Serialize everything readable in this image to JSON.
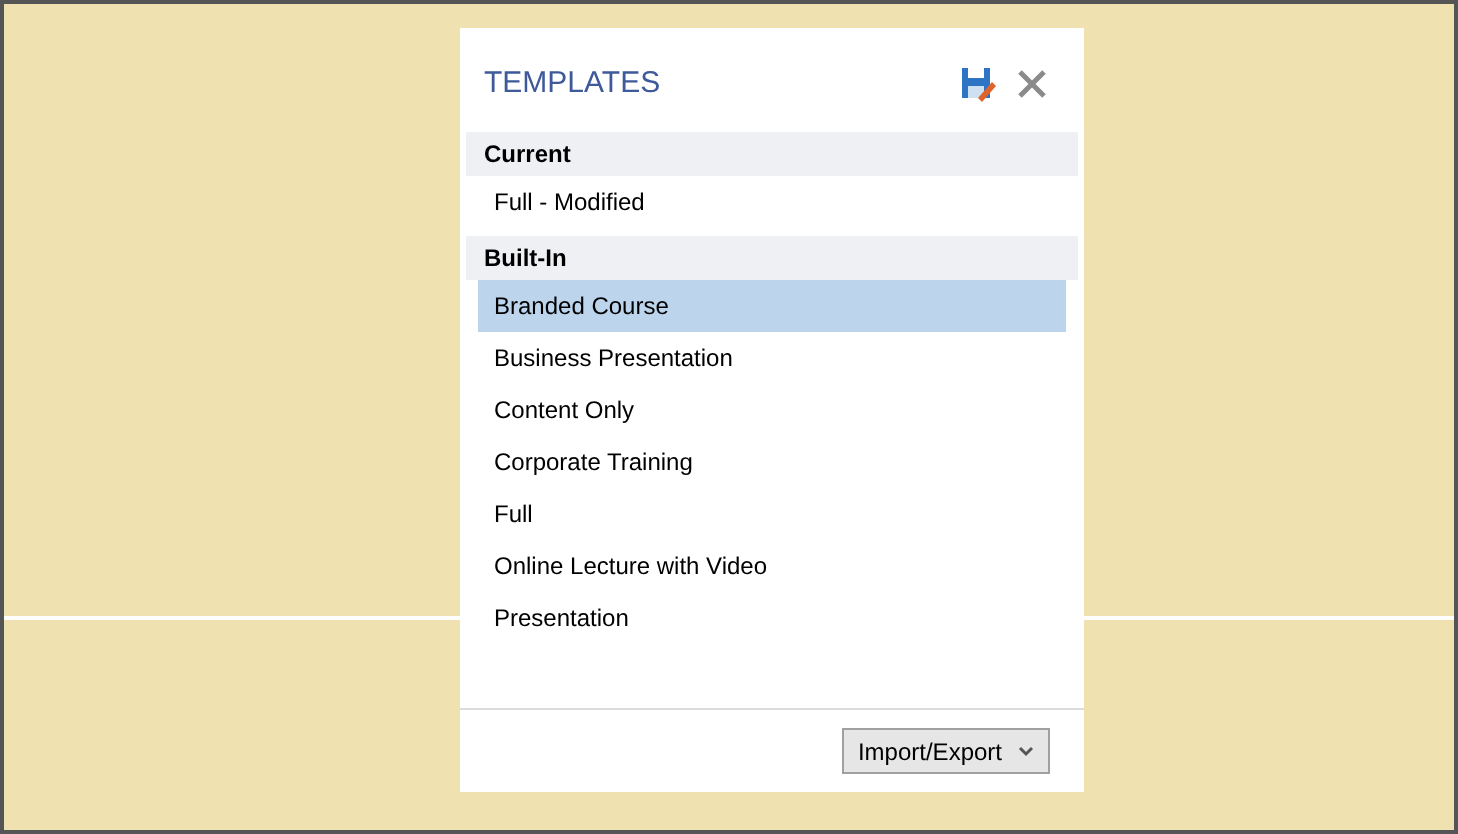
{
  "panel": {
    "title": "TEMPLATES"
  },
  "groups": [
    {
      "heading": "Current",
      "items": [
        {
          "label": "Full - Modified",
          "selected": false
        }
      ]
    },
    {
      "heading": "Built-In",
      "items": [
        {
          "label": "Branded Course",
          "selected": true
        },
        {
          "label": "Business Presentation",
          "selected": false
        },
        {
          "label": "Content Only",
          "selected": false
        },
        {
          "label": "Corporate Training",
          "selected": false
        },
        {
          "label": "Full",
          "selected": false
        },
        {
          "label": "Online Lecture with Video",
          "selected": false
        },
        {
          "label": "Presentation",
          "selected": false
        }
      ]
    }
  ],
  "footer": {
    "button": "Import/Export"
  }
}
